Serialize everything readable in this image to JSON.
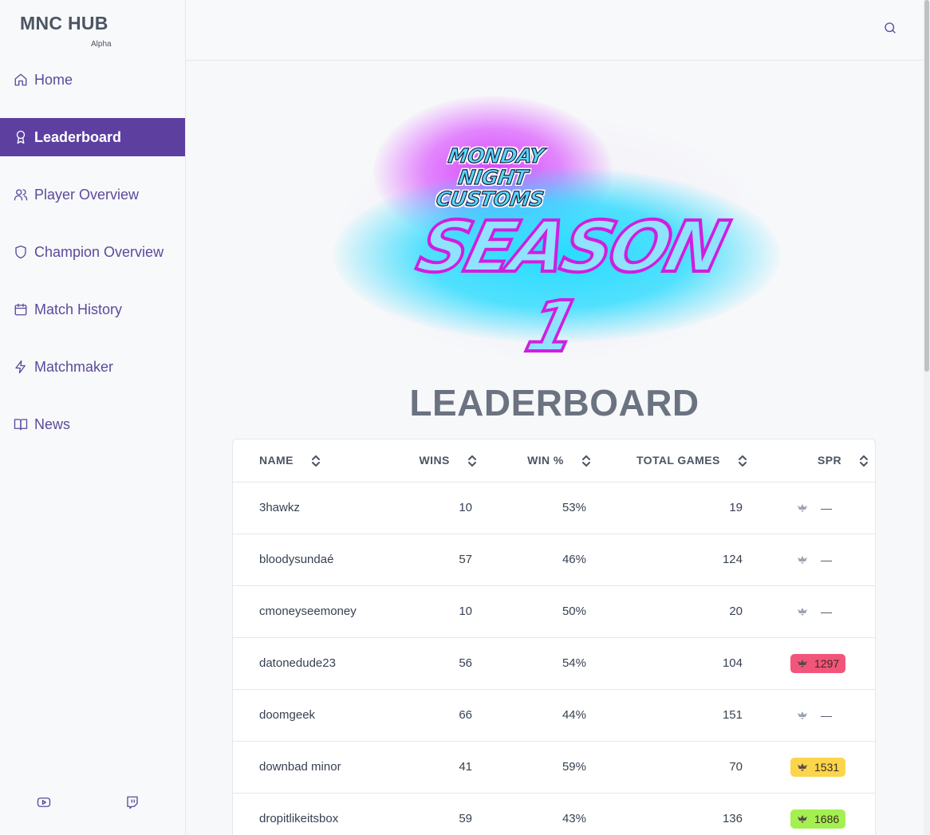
{
  "brand": {
    "title": "MNC HUB",
    "subtitle": "Alpha"
  },
  "nav": [
    {
      "label": "Home",
      "icon": "home-icon",
      "active": false
    },
    {
      "label": "Leaderboard",
      "icon": "award-icon",
      "active": true
    },
    {
      "label": "Player Overview",
      "icon": "users-icon",
      "active": false
    },
    {
      "label": "Champion Overview",
      "icon": "shield-icon",
      "active": false
    },
    {
      "label": "Match History",
      "icon": "calendar-icon",
      "active": false
    },
    {
      "label": "Matchmaker",
      "icon": "lightning-icon",
      "active": false
    },
    {
      "label": "News",
      "icon": "book-icon",
      "active": false
    }
  ],
  "social": {
    "youtube": "youtube-icon",
    "twitch": "twitch-icon"
  },
  "banner": {
    "line1": "MONDAY",
    "line2": "NIGHT",
    "line3": "CUSTOMS",
    "season": "SEASON 1"
  },
  "page_title": "LEADERBOARD",
  "table": {
    "headers": {
      "name": "NAME",
      "wins": "WINS",
      "win_pct": "WIN %",
      "total": "TOTAL GAMES",
      "spr": "SPR"
    },
    "rows": [
      {
        "name": "3hawkz",
        "wins": "10",
        "win_pct": "53%",
        "total": "19",
        "spr": "—",
        "spr_color": ""
      },
      {
        "name": "bloodysundaé",
        "wins": "57",
        "win_pct": "46%",
        "total": "124",
        "spr": "—",
        "spr_color": ""
      },
      {
        "name": "cmoneyseemoney",
        "wins": "10",
        "win_pct": "50%",
        "total": "20",
        "spr": "—",
        "spr_color": ""
      },
      {
        "name": "datonedude23",
        "wins": "56",
        "win_pct": "54%",
        "total": "104",
        "spr": "1297",
        "spr_color": "#f2557a"
      },
      {
        "name": "doomgeek",
        "wins": "66",
        "win_pct": "44%",
        "total": "151",
        "spr": "—",
        "spr_color": ""
      },
      {
        "name": "downbad minor",
        "wins": "41",
        "win_pct": "59%",
        "total": "70",
        "spr": "1531",
        "spr_color": "#fbd54b"
      },
      {
        "name": "dropitlikeitsbox",
        "wins": "59",
        "win_pct": "43%",
        "total": "136",
        "spr": "1686",
        "spr_color": "#a3f050"
      }
    ]
  },
  "colors": {
    "accent": "#5d3fa0",
    "nav_text": "#5b4a9a"
  }
}
